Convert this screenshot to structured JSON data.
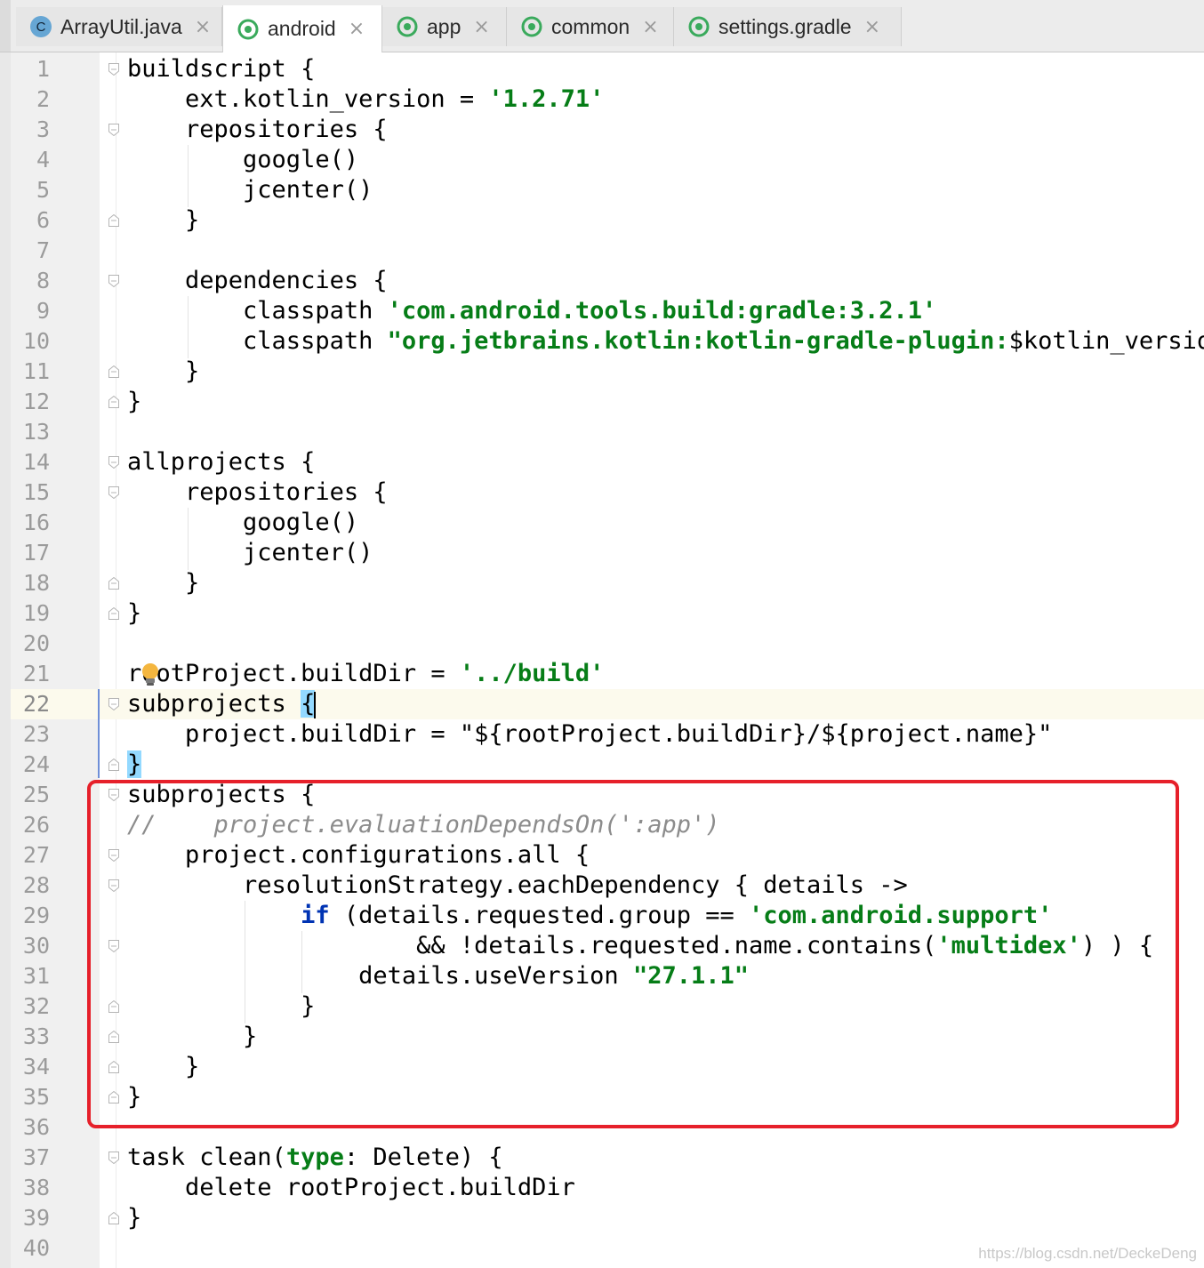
{
  "tabs": [
    {
      "label": "ArrayUtil.java",
      "icon": "java-class-icon",
      "active": false
    },
    {
      "label": "android",
      "icon": "gradle-icon",
      "active": true
    },
    {
      "label": "app",
      "icon": "gradle-icon",
      "active": false
    },
    {
      "label": "common",
      "icon": "gradle-icon",
      "active": false
    },
    {
      "label": "settings.gradle",
      "icon": "gradle-icon",
      "active": false
    }
  ],
  "tab_close_glyph": "×",
  "class_icon_letter": "C",
  "line_numbers": [
    "1",
    "2",
    "3",
    "4",
    "5",
    "6",
    "7",
    "8",
    "9",
    "10",
    "11",
    "12",
    "13",
    "14",
    "15",
    "16",
    "17",
    "18",
    "19",
    "20",
    "21",
    "22",
    "23",
    "24",
    "25",
    "26",
    "27",
    "28",
    "29",
    "30",
    "31",
    "32",
    "33",
    "34",
    "35",
    "36",
    "37",
    "38",
    "39",
    "40"
  ],
  "current_line": 22,
  "code": {
    "l1": "buildscript {",
    "l2a": "    ext.kotlin_version = ",
    "l2b": "'1.2.71'",
    "l3": "    repositories {",
    "l4": "        google()",
    "l5": "        jcenter()",
    "l6": "    }",
    "l8": "    dependencies {",
    "l9a": "        classpath ",
    "l9b": "'com.android.tools.build:gradle:3.2.1'",
    "l10a": "        classpath ",
    "l10b": "\"org.jetbrains.kotlin:kotlin-gradle-plugin:",
    "l10c": "$kotlin_version",
    "l11": "    }",
    "l12": "}",
    "l14": "allprojects {",
    "l15": "    repositories {",
    "l16": "        google()",
    "l17": "        jcenter()",
    "l18": "    }",
    "l19": "}",
    "l21a": "rootProject.buildDir = ",
    "l21b": "'../build'",
    "l22a": "subprojects ",
    "l22b": "{",
    "l23a": "    project.buildDir = ",
    "l23b": "\"${rootProject.buildDir}/${project.name}\"",
    "l24": "}",
    "l25": "subprojects {",
    "l26": "//    project.evaluationDependsOn(':app')",
    "l27": "    project.configurations.all {",
    "l28": "        resolutionStrategy.eachDependency { details ->",
    "l29a": "            ",
    "l29b": "if",
    "l29c": " (details.requested.group == ",
    "l29d": "'com.android.support'",
    "l30a": "                    && !details.requested.name.contains(",
    "l30b": "'multidex'",
    "l30c": ") ) {",
    "l31a": "                details.useVersion ",
    "l31b": "\"27.1.1\"",
    "l32": "            }",
    "l33": "        }",
    "l34": "    }",
    "l35": "}",
    "l37a": "task clean(",
    "l37b": "type",
    "l37c": ": Delete) {",
    "l38": "    delete rootProject.buildDir",
    "l39": "}"
  },
  "watermark": "https://blog.csdn.net/DeckeDeng",
  "colors": {
    "string": "#067d17",
    "keyword": "#0033b3",
    "comment": "#8c8c8c",
    "highlight_box": "#e6202a",
    "current_line": "#fcfaed",
    "brace_match": "#93d9ff"
  }
}
